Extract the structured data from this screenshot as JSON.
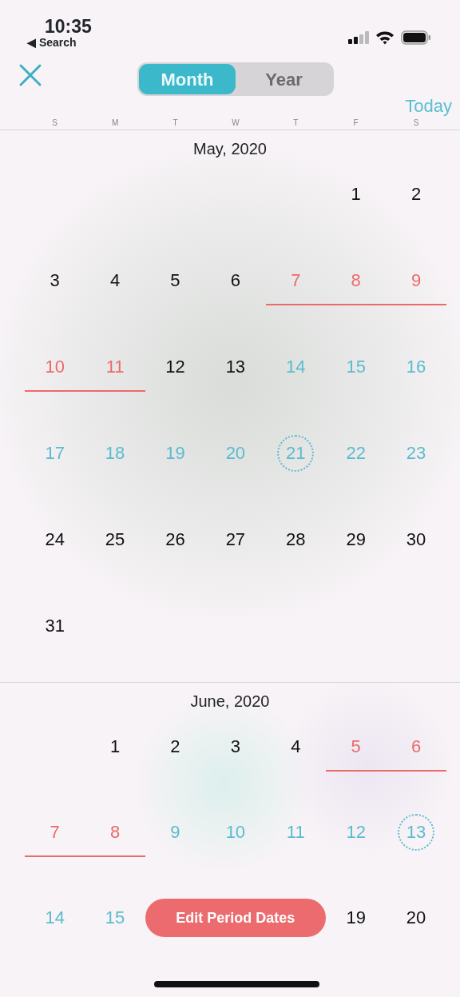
{
  "status_bar": {
    "time": "10:35",
    "back_label": "◀ Search"
  },
  "toolbar": {
    "tabs": [
      {
        "label": "Month",
        "selected": true
      },
      {
        "label": "Year",
        "selected": false
      }
    ],
    "today_label": "Today"
  },
  "weekdays": [
    "S",
    "M",
    "T",
    "W",
    "T",
    "F",
    "S"
  ],
  "months": [
    {
      "title": "May, 2020",
      "weeks": [
        [
          {
            "kind": "blank"
          },
          {
            "kind": "blank"
          },
          {
            "kind": "blank"
          },
          {
            "kind": "blank"
          },
          {
            "kind": "blank"
          },
          {
            "label": "1",
            "kind": "normal"
          },
          {
            "label": "2",
            "kind": "normal"
          }
        ],
        [
          {
            "label": "3",
            "kind": "normal"
          },
          {
            "label": "4",
            "kind": "normal"
          },
          {
            "label": "5",
            "kind": "normal"
          },
          {
            "label": "6",
            "kind": "normal"
          },
          {
            "label": "7",
            "kind": "period"
          },
          {
            "label": "8",
            "kind": "period"
          },
          {
            "label": "9",
            "kind": "period"
          }
        ],
        [
          {
            "label": "10",
            "kind": "period"
          },
          {
            "label": "11",
            "kind": "period"
          },
          {
            "label": "12",
            "kind": "normal"
          },
          {
            "label": "13",
            "kind": "normal"
          },
          {
            "label": "14",
            "kind": "fertile"
          },
          {
            "label": "15",
            "kind": "fertile"
          },
          {
            "label": "16",
            "kind": "fertile"
          }
        ],
        [
          {
            "label": "17",
            "kind": "fertile"
          },
          {
            "label": "18",
            "kind": "fertile"
          },
          {
            "label": "19",
            "kind": "fertile"
          },
          {
            "label": "20",
            "kind": "fertile"
          },
          {
            "label": "21",
            "kind": "ovulation"
          },
          {
            "label": "22",
            "kind": "fertile"
          },
          {
            "label": "23",
            "kind": "fertile"
          }
        ],
        [
          {
            "label": "24",
            "kind": "normal"
          },
          {
            "label": "25",
            "kind": "normal"
          },
          {
            "label": "26",
            "kind": "normal"
          },
          {
            "label": "27",
            "kind": "normal"
          },
          {
            "label": "28",
            "kind": "normal"
          },
          {
            "label": "29",
            "kind": "normal"
          },
          {
            "label": "30",
            "kind": "normal"
          }
        ],
        [
          {
            "label": "31",
            "kind": "normal"
          }
        ]
      ]
    },
    {
      "title": "June, 2020",
      "weeks": [
        [
          {
            "kind": "blank"
          },
          {
            "label": "1",
            "kind": "normal"
          },
          {
            "label": "2",
            "kind": "normal"
          },
          {
            "label": "3",
            "kind": "normal"
          },
          {
            "label": "4",
            "kind": "normal"
          },
          {
            "label": "5",
            "kind": "period"
          },
          {
            "label": "6",
            "kind": "period"
          }
        ],
        [
          {
            "label": "7",
            "kind": "period"
          },
          {
            "label": "8",
            "kind": "period"
          },
          {
            "label": "9",
            "kind": "fertile"
          },
          {
            "label": "10",
            "kind": "fertile"
          },
          {
            "label": "11",
            "kind": "fertile"
          },
          {
            "label": "12",
            "kind": "fertile"
          },
          {
            "label": "13",
            "kind": "ovulation"
          }
        ],
        [
          {
            "label": "14",
            "kind": "fertile"
          },
          {
            "label": "15",
            "kind": "fertile"
          },
          {
            "label": "Edit Period Dates",
            "kind": "action"
          },
          {
            "label": "19",
            "kind": "normal"
          },
          {
            "label": "20",
            "kind": "normal"
          }
        ]
      ]
    }
  ]
}
